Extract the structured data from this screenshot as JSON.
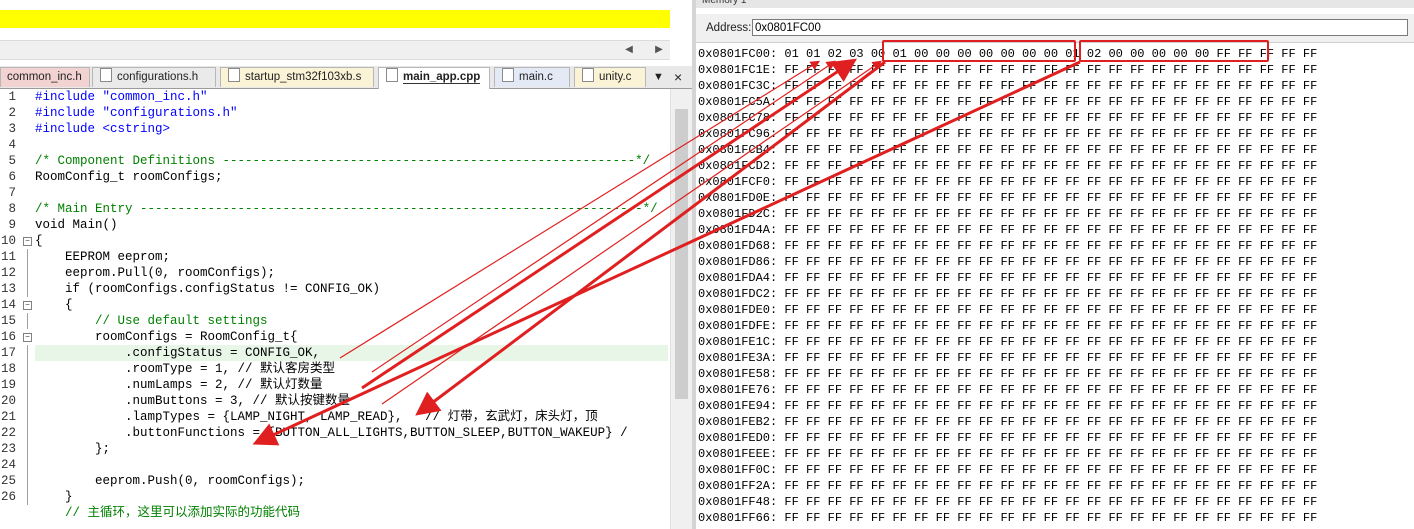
{
  "editor": {
    "tabs": [
      {
        "label": "common_inc.h",
        "active": false
      },
      {
        "label": "configurations.h",
        "active": false
      },
      {
        "label": "startup_stm32f103xb.s",
        "active": false
      },
      {
        "label": "main_app.cpp",
        "active": true
      },
      {
        "label": "main.c",
        "active": false
      },
      {
        "label": "unity.c",
        "active": false
      }
    ],
    "tab_menu_glyph": "▼",
    "tab_close_glyph": "×",
    "line_numbers": [
      "1",
      "2",
      "3",
      "4",
      "5",
      "6",
      "7",
      "8",
      "9",
      "10",
      "11",
      "12",
      "13",
      "14",
      "15",
      "16",
      "17",
      "18",
      "19",
      "20",
      "21",
      "22",
      "23",
      "24",
      "25",
      "26"
    ],
    "code_lines": [
      "#include \"common_inc.h\"",
      "#include \"configurations.h\"",
      "#include <cstring>",
      "",
      "/* Component Definitions -------------------------------------------------------*/",
      "RoomConfig_t roomConfigs;",
      "",
      "/* Main Entry -------------------------------------------------------------------*/",
      "void Main()",
      "{",
      "    EEPROM eeprom;",
      "    eeprom.Pull(0, roomConfigs);",
      "    if (roomConfigs.configStatus != CONFIG_OK)",
      "    {",
      "        // Use default settings",
      "        roomConfigs = RoomConfig_t{",
      "            .configStatus = CONFIG_OK,",
      "            .roomType = 1, // 默认客房类型",
      "            .numLamps = 2, // 默认灯数量",
      "            .numButtons = 3, // 默认按键数量",
      "            .lampTypes = {LAMP_NIGHT, LAMP_READ},   // 灯带，玄武灯，床头灯，顶",
      "            .buttonFunctions = {BUTTON_ALL_LIGHTS,BUTTON_SLEEP,BUTTON_WAKEUP} /",
      "        };",
      "",
      "        eeprom.Push(0, roomConfigs);",
      "    }",
      "    // 主循环，这里可以添加实际的功能代码"
    ]
  },
  "memory": {
    "title": "Memory 1",
    "address_label": "Address:",
    "address_value": "0x0801FC00",
    "rows": [
      {
        "addr": "0x0801FC00:",
        "bytes": "01 01 02 03 00 01 00 00 00 00 00 00 00 01 02 00 00 00 00 00 FF FF FF FF FF"
      },
      {
        "addr": "0x0801FC1E:",
        "bytes": "FF FF FF FF FF FF FF FF FF FF FF FF FF FF FF FF FF FF FF FF FF FF FF FF FF"
      },
      {
        "addr": "0x0801FC3C:",
        "bytes": "FF FF FF FF FF FF FF FF FF FF FF FF FF FF FF FF FF FF FF FF FF FF FF FF FF"
      },
      {
        "addr": "0x0801FC5A:",
        "bytes": "FF FF FF FF FF FF FF FF FF FF FF FF FF FF FF FF FF FF FF FF FF FF FF FF FF"
      },
      {
        "addr": "0x0801FC78:",
        "bytes": "FF FF FF FF FF FF FF FF FF FF FF FF FF FF FF FF FF FF FF FF FF FF FF FF FF"
      },
      {
        "addr": "0x0801FC96:",
        "bytes": "FF FF FF FF FF FF FF FF FF FF FF FF FF FF FF FF FF FF FF FF FF FF FF FF FF"
      },
      {
        "addr": "0x0801FCB4:",
        "bytes": "FF FF FF FF FF FF FF FF FF FF FF FF FF FF FF FF FF FF FF FF FF FF FF FF FF"
      },
      {
        "addr": "0x0801FCD2:",
        "bytes": "FF FF FF FF FF FF FF FF FF FF FF FF FF FF FF FF FF FF FF FF FF FF FF FF FF"
      },
      {
        "addr": "0x0801FCF0:",
        "bytes": "FF FF FF FF FF FF FF FF FF FF FF FF FF FF FF FF FF FF FF FF FF FF FF FF FF"
      },
      {
        "addr": "0x0801FD0E:",
        "bytes": "FF FF FF FF FF FF FF FF FF FF FF FF FF FF FF FF FF FF FF FF FF FF FF FF FF"
      },
      {
        "addr": "0x0801FD2C:",
        "bytes": "FF FF FF FF FF FF FF FF FF FF FF FF FF FF FF FF FF FF FF FF FF FF FF FF FF"
      },
      {
        "addr": "0x0801FD4A:",
        "bytes": "FF FF FF FF FF FF FF FF FF FF FF FF FF FF FF FF FF FF FF FF FF FF FF FF FF"
      },
      {
        "addr": "0x0801FD68:",
        "bytes": "FF FF FF FF FF FF FF FF FF FF FF FF FF FF FF FF FF FF FF FF FF FF FF FF FF"
      },
      {
        "addr": "0x0801FD86:",
        "bytes": "FF FF FF FF FF FF FF FF FF FF FF FF FF FF FF FF FF FF FF FF FF FF FF FF FF"
      },
      {
        "addr": "0x0801FDA4:",
        "bytes": "FF FF FF FF FF FF FF FF FF FF FF FF FF FF FF FF FF FF FF FF FF FF FF FF FF"
      },
      {
        "addr": "0x0801FDC2:",
        "bytes": "FF FF FF FF FF FF FF FF FF FF FF FF FF FF FF FF FF FF FF FF FF FF FF FF FF"
      },
      {
        "addr": "0x0801FDE0:",
        "bytes": "FF FF FF FF FF FF FF FF FF FF FF FF FF FF FF FF FF FF FF FF FF FF FF FF FF"
      },
      {
        "addr": "0x0801FDFE:",
        "bytes": "FF FF FF FF FF FF FF FF FF FF FF FF FF FF FF FF FF FF FF FF FF FF FF FF FF"
      },
      {
        "addr": "0x0801FE1C:",
        "bytes": "FF FF FF FF FF FF FF FF FF FF FF FF FF FF FF FF FF FF FF FF FF FF FF FF FF"
      },
      {
        "addr": "0x0801FE3A:",
        "bytes": "FF FF FF FF FF FF FF FF FF FF FF FF FF FF FF FF FF FF FF FF FF FF FF FF FF"
      },
      {
        "addr": "0x0801FE58:",
        "bytes": "FF FF FF FF FF FF FF FF FF FF FF FF FF FF FF FF FF FF FF FF FF FF FF FF FF"
      },
      {
        "addr": "0x0801FE76:",
        "bytes": "FF FF FF FF FF FF FF FF FF FF FF FF FF FF FF FF FF FF FF FF FF FF FF FF FF"
      },
      {
        "addr": "0x0801FE94:",
        "bytes": "FF FF FF FF FF FF FF FF FF FF FF FF FF FF FF FF FF FF FF FF FF FF FF FF FF"
      },
      {
        "addr": "0x0801FEB2:",
        "bytes": "FF FF FF FF FF FF FF FF FF FF FF FF FF FF FF FF FF FF FF FF FF FF FF FF FF"
      },
      {
        "addr": "0x0801FED0:",
        "bytes": "FF FF FF FF FF FF FF FF FF FF FF FF FF FF FF FF FF FF FF FF FF FF FF FF FF"
      },
      {
        "addr": "0x0801FEEE:",
        "bytes": "FF FF FF FF FF FF FF FF FF FF FF FF FF FF FF FF FF FF FF FF FF FF FF FF FF"
      },
      {
        "addr": "0x0801FF0C:",
        "bytes": "FF FF FF FF FF FF FF FF FF FF FF FF FF FF FF FF FF FF FF FF FF FF FF FF FF"
      },
      {
        "addr": "0x0801FF2A:",
        "bytes": "FF FF FF FF FF FF FF FF FF FF FF FF FF FF FF FF FF FF FF FF FF FF FF FF FF"
      },
      {
        "addr": "0x0801FF48:",
        "bytes": "FF FF FF FF FF FF FF FF FF FF FF FF FF FF FF FF FF FF FF FF FF FF FF FF FF"
      },
      {
        "addr": "0x0801FF66:",
        "bytes": "FF FF FF FF FF FF FF FF FF FF FF FF FF FF FF FF FF FF FF FF FF FF FF FF FF"
      }
    ]
  },
  "colors": {
    "annotation": "#e02020",
    "highlight_bar": "#ffff00",
    "current_line": "#e8f6e8",
    "keyword": "#0000ff",
    "string": "#a31515",
    "comment": "#008000"
  }
}
